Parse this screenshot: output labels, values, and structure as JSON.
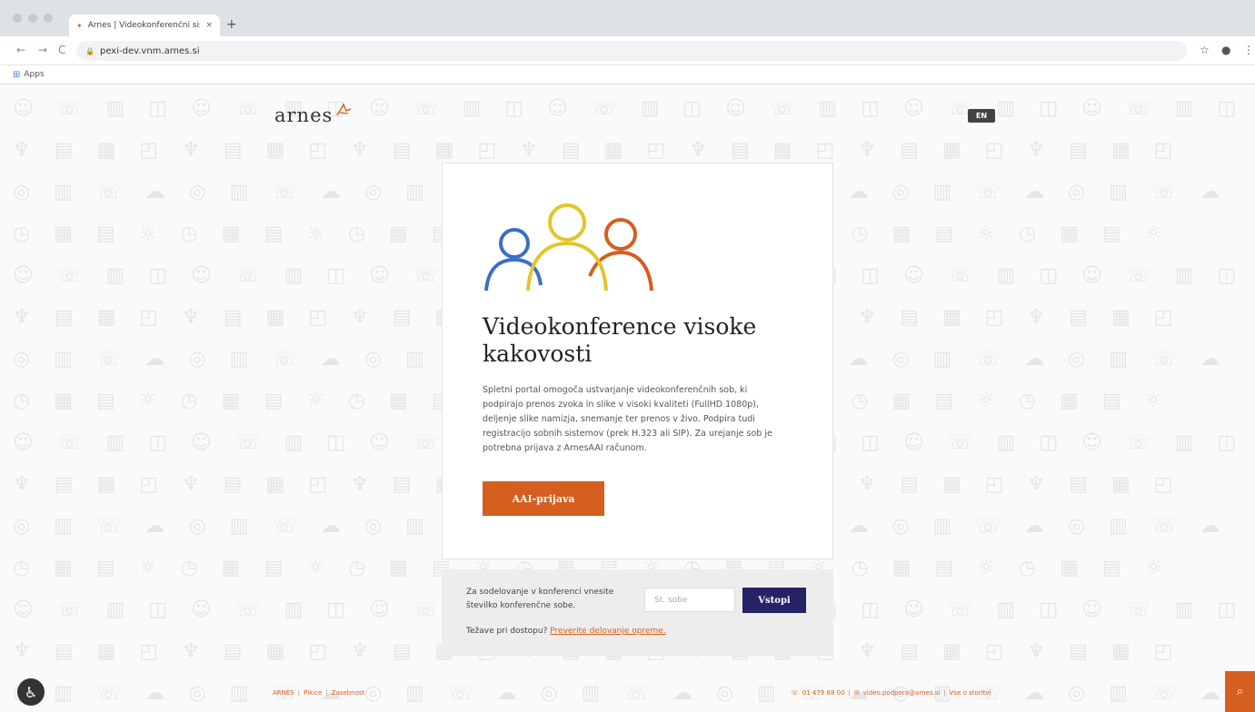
{
  "browser": {
    "tab_title": "Arnes | Videokonferenčni sist",
    "tab_close": "×",
    "new_tab": "+",
    "url": "pexi-dev.vnm.arnes.si",
    "bookmarks_label": "Apps",
    "back": "←",
    "forward": "→",
    "reload": "C",
    "star": "☆",
    "account": "●",
    "menu": "⋮"
  },
  "logo_text": "arnes",
  "lang_toggle": "EN",
  "card": {
    "title": "Videokonference visoke kakovosti",
    "description": "Spletni portal omogoča ustvarjanje videokonferenčnih sob, ki podpirajo prenos zvoka in slike v visoki kvaliteti (FullHD 1080p), deljenje slike namizja, snemanje ter prenos v živo. Podpira tudi registracijo sobnih sistemov (prek H.323 ali SIP). Za urejanje sob je potrebna prijava z ArnesAAI računom.",
    "login_button": "AAI-prijava",
    "people_colors": [
      "#3a6fc4",
      "#e2c62a",
      "#d65e1e"
    ]
  },
  "join": {
    "hint": "Za sodelovanje v konferenci vnesite številko konferenčne sobe.",
    "room_placeholder": "Št. sobe",
    "enter_button": "Vstopi",
    "trouble_text": "Težave pri dostopu?",
    "trouble_link": "Preverite delovanje opreme."
  },
  "footer": {
    "left_links": [
      "ARNES",
      "Pikice",
      "Zasebnost"
    ],
    "separator": "|",
    "phone": "01 479 88 00",
    "email": "video.podpora@arnes.si",
    "extra_link": "Vse o storitvi"
  },
  "colors": {
    "accent": "#d65e1e",
    "dark_button": "#262266"
  }
}
